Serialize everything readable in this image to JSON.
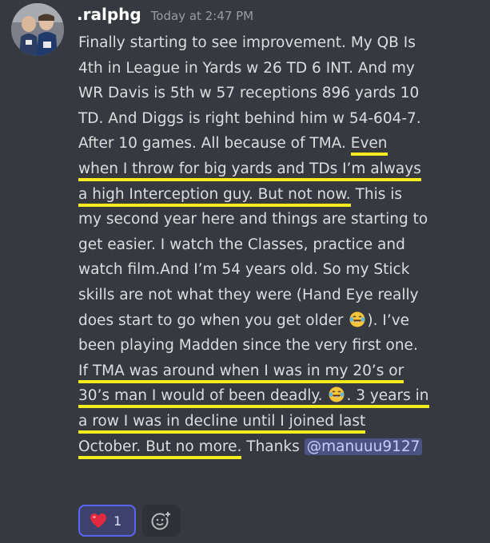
{
  "message": {
    "username": ".ralphg",
    "timestamp": "Today at 2:47 PM",
    "lines": [
      "Finally starting to see improvement.  My QB Is",
      "4th in League in Yards w 26 TD 6 INT.  And my",
      "WR Davis is 5th w 57 receptions 896 yards 10",
      "TD. And Diggs is right behind him w 54-604-7.",
      "After 10 games.  All because of TMA.",
      "Even",
      "when I throw for big yards and TDs I’m always",
      "a high Interception guy.  But not now.",
      " This is",
      "my second year here and things are starting to",
      "get easier.  I watch the Classes, practice and",
      "watch film.And I’m 54 years old. So my Stick",
      "skills are not what they were (Hand Eye really",
      "does start to go when you get older",
      "). I’ve",
      "been playing Madden since the very first one.",
      "If TMA was around when I was in my 20’s or",
      "30’s man I would of been deadly.",
      ". 3 years in",
      "a row I was in decline until I joined last",
      "October.  But no more.",
      "  Thanks ",
      "@manuuu9127"
    ],
    "emoji": "laughing-tears-emoji"
  },
  "reactions": {
    "heart": {
      "emoji": "heart-emoji",
      "count": "1"
    },
    "add_reaction_icon": "add-reaction-icon"
  },
  "colors": {
    "background": "#36393f",
    "highlight_underline": "#f4ec1c",
    "mention_bg": "#4a5382",
    "reaction_border": "#5865f2"
  }
}
